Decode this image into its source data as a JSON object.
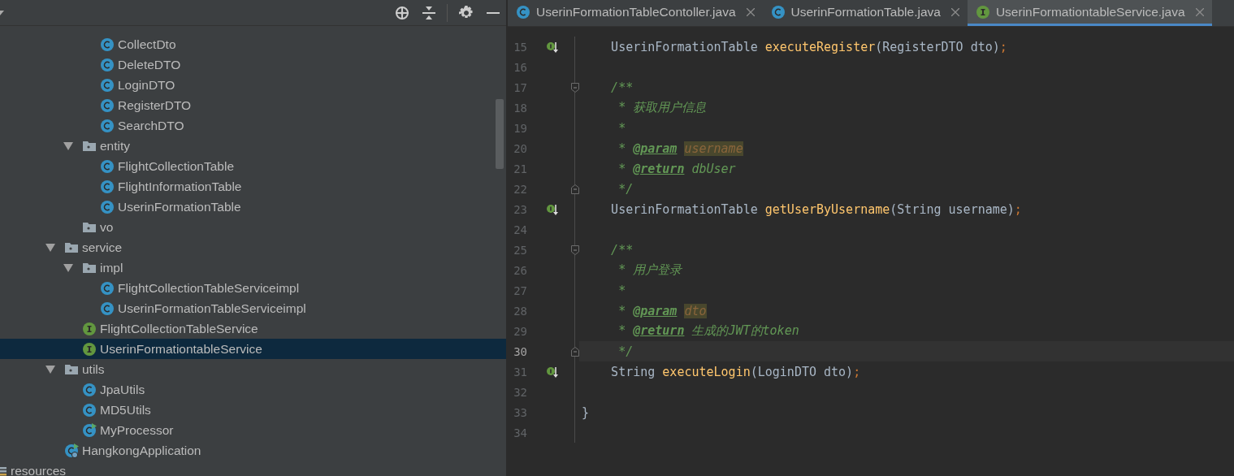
{
  "project_panel": {
    "tree": [
      {
        "children": [
          {
            "children": [
              {
                "children": [
                  {
                    "children": [
                      {
                        "children": [
                          {
                            "children": [
                              {
                                "label": "CollectDto",
                                "kind": "class",
                                "selected": false
                              },
                              {
                                "label": "DeleteDTO",
                                "kind": "class",
                                "selected": false
                              },
                              {
                                "label": "LoginDTO",
                                "kind": "class",
                                "selected": false
                              },
                              {
                                "label": "RegisterDTO",
                                "kind": "class",
                                "selected": false
                              },
                              {
                                "label": "SearchDTO",
                                "kind": "class",
                                "selected": false
                              }
                            ]
                          },
                          {
                            "label": "entity",
                            "kind": "folder",
                            "expanded": true,
                            "selected": false,
                            "children": [
                              {
                                "label": "FlightCollectionTable",
                                "kind": "class",
                                "selected": false
                              },
                              {
                                "label": "FlightInformationTable",
                                "kind": "class",
                                "selected": false
                              },
                              {
                                "label": "UserinFormationTable",
                                "kind": "class",
                                "selected": false
                              }
                            ]
                          },
                          {
                            "label": "vo",
                            "kind": "folder",
                            "selected": false
                          }
                        ]
                      },
                      {
                        "label": "service",
                        "kind": "folder",
                        "expanded": true,
                        "selected": false,
                        "children": [
                          {
                            "label": "impl",
                            "kind": "folder",
                            "expanded": true,
                            "selected": false,
                            "children": [
                              {
                                "label": "FlightCollectionTableServiceimpl",
                                "kind": "class",
                                "selected": false
                              },
                              {
                                "label": "UserinFormationTableServiceimpl",
                                "kind": "class",
                                "selected": false
                              }
                            ]
                          },
                          {
                            "label": "FlightCollectionTableService",
                            "kind": "interface",
                            "selected": false
                          },
                          {
                            "label": "UserinFormationtableService",
                            "kind": "interface",
                            "selected": true
                          }
                        ]
                      },
                      {
                        "label": "utils",
                        "kind": "folder",
                        "expanded": true,
                        "selected": false,
                        "children": [
                          {
                            "label": "JpaUtils",
                            "kind": "class",
                            "selected": false
                          },
                          {
                            "label": "MD5Utils",
                            "kind": "class",
                            "selected": false
                          },
                          {
                            "label": "MyProcessor",
                            "kind": "runnable-class",
                            "selected": false
                          }
                        ]
                      },
                      {
                        "label": "HangkongApplication",
                        "kind": "app",
                        "selected": false
                      }
                    ]
                  }
                ]
              }
            ]
          }
        ]
      },
      {
        "label": "resources",
        "kind": "resources",
        "selected": false
      }
    ]
  },
  "editor": {
    "tabs": [
      {
        "label": "UserinFormationTableContoller.java",
        "kind": "class",
        "selected": false
      },
      {
        "label": "UserinFormationTable.java",
        "kind": "class",
        "selected": false
      },
      {
        "label": "UserinFormationtableService.java",
        "kind": "interface",
        "selected": true
      }
    ],
    "lines": [
      {
        "number": "15",
        "current": false,
        "implemented": true,
        "fold_open": false,
        "fold_close": false,
        "tokens": [
          {
            "text": "    UserinFormationTable ",
            "kind": "plain"
          },
          {
            "text": "executeRegister",
            "kind": "method"
          },
          {
            "text": "(RegisterDTO dto)",
            "kind": "plain"
          },
          {
            "text": ";",
            "kind": "punct"
          }
        ]
      },
      {
        "number": "16",
        "current": false,
        "implemented": false,
        "fold_open": false,
        "fold_close": false
      },
      {
        "number": "17",
        "current": false,
        "implemented": false,
        "fold_open": true,
        "fold_close": false,
        "tokens": [
          {
            "text": "    /**",
            "kind": "comment"
          }
        ]
      },
      {
        "number": "18",
        "current": false,
        "implemented": false,
        "fold_open": false,
        "fold_close": false,
        "tokens": [
          {
            "text": "     * 获取用户信息",
            "kind": "comment"
          }
        ]
      },
      {
        "number": "19",
        "current": false,
        "implemented": false,
        "fold_open": false,
        "fold_close": false,
        "tokens": [
          {
            "text": "     *",
            "kind": "comment"
          }
        ]
      },
      {
        "number": "20",
        "current": false,
        "implemented": false,
        "fold_open": false,
        "fold_close": false,
        "tokens": [
          {
            "text": "     * ",
            "kind": "comment"
          },
          {
            "text": "@param",
            "kind": "tag"
          },
          {
            "text": " username",
            "kind": "param-ref"
          }
        ]
      },
      {
        "number": "21",
        "current": false,
        "implemented": false,
        "fold_open": false,
        "fold_close": false,
        "tokens": [
          {
            "text": "     * ",
            "kind": "comment"
          },
          {
            "text": "@return",
            "kind": "tag"
          },
          {
            "text": " dbUser",
            "kind": "comment"
          }
        ]
      },
      {
        "number": "22",
        "current": false,
        "implemented": false,
        "fold_open": false,
        "fold_close": true,
        "tokens": [
          {
            "text": "     */",
            "kind": "comment"
          }
        ]
      },
      {
        "number": "23",
        "current": false,
        "implemented": true,
        "fold_open": false,
        "fold_close": false,
        "tokens": [
          {
            "text": "    UserinFormationTable ",
            "kind": "plain"
          },
          {
            "text": "getUserByUsername",
            "kind": "method"
          },
          {
            "text": "(String username)",
            "kind": "plain"
          },
          {
            "text": ";",
            "kind": "punct"
          }
        ]
      },
      {
        "number": "24",
        "current": false,
        "implemented": false,
        "fold_open": false,
        "fold_close": false
      },
      {
        "number": "25",
        "current": false,
        "implemented": false,
        "fold_open": true,
        "fold_close": false,
        "tokens": [
          {
            "text": "    /**",
            "kind": "comment"
          }
        ]
      },
      {
        "number": "26",
        "current": false,
        "implemented": false,
        "fold_open": false,
        "fold_close": false,
        "tokens": [
          {
            "text": "     * 用户登录",
            "kind": "comment"
          }
        ]
      },
      {
        "number": "27",
        "current": false,
        "implemented": false,
        "fold_open": false,
        "fold_close": false,
        "tokens": [
          {
            "text": "     *",
            "kind": "comment"
          }
        ]
      },
      {
        "number": "28",
        "current": false,
        "implemented": false,
        "fold_open": false,
        "fold_close": false,
        "tokens": [
          {
            "text": "     * ",
            "kind": "comment"
          },
          {
            "text": "@param",
            "kind": "tag"
          },
          {
            "text": " dto",
            "kind": "param-ref"
          }
        ]
      },
      {
        "number": "29",
        "current": false,
        "implemented": false,
        "fold_open": false,
        "fold_close": false,
        "tokens": [
          {
            "text": "     * ",
            "kind": "comment"
          },
          {
            "text": "@return",
            "kind": "tag"
          },
          {
            "text": " 生成的JWT的token",
            "kind": "comment"
          }
        ]
      },
      {
        "number": "30",
        "current": true,
        "implemented": false,
        "fold_open": false,
        "fold_close": true,
        "tokens": [
          {
            "text": "     */",
            "kind": "comment"
          }
        ]
      },
      {
        "number": "31",
        "current": false,
        "implemented": true,
        "fold_open": false,
        "fold_close": false,
        "tokens": [
          {
            "text": "    String ",
            "kind": "plain"
          },
          {
            "text": "executeLogin",
            "kind": "method"
          },
          {
            "text": "(LoginDTO dto)",
            "kind": "plain"
          },
          {
            "text": ";",
            "kind": "punct"
          }
        ]
      },
      {
        "number": "32",
        "current": false,
        "implemented": false,
        "fold_open": false,
        "fold_close": false
      },
      {
        "number": "33",
        "current": false,
        "implemented": false,
        "fold_open": false,
        "fold_close": false,
        "tokens": [
          {
            "text": "}",
            "kind": "plain"
          }
        ]
      },
      {
        "number": "34",
        "current": false,
        "implemented": false,
        "fold_open": false,
        "fold_close": false
      }
    ]
  }
}
